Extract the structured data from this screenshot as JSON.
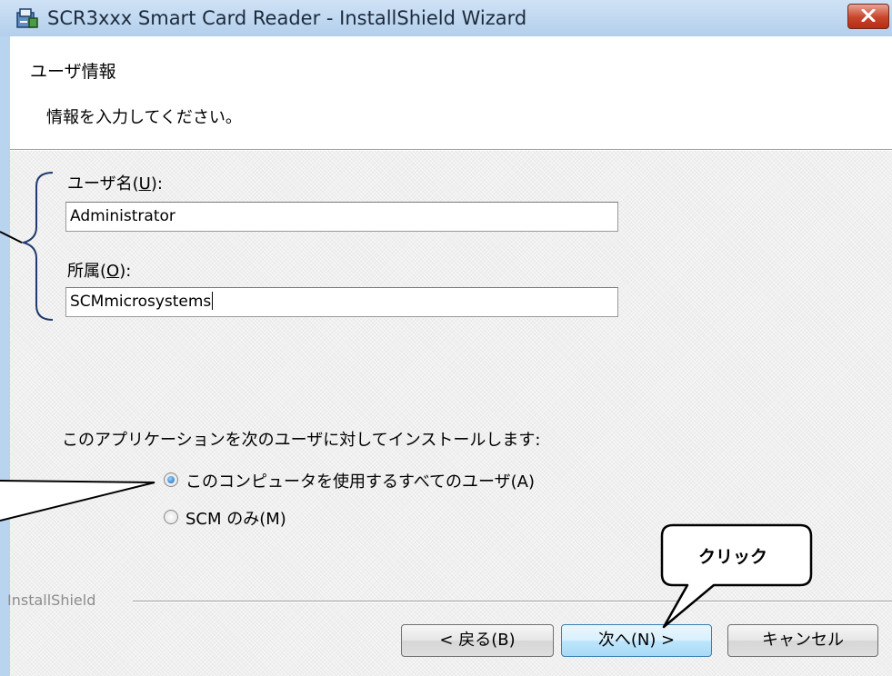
{
  "window": {
    "title": "SCR3xxx Smart Card Reader - InstallShield Wizard",
    "icon": "installer-icon"
  },
  "header": {
    "title": "ユーザ情報",
    "subtitle": "情報を入力してください。"
  },
  "form": {
    "username": {
      "label_prefix": "ユーザ名(",
      "label_key": "U",
      "label_suffix": "):",
      "value": "Administrator"
    },
    "organization": {
      "label_prefix": "所属(",
      "label_key": "O",
      "label_suffix": "):",
      "value": "SCMmicrosystems"
    }
  },
  "install_for": {
    "prompt": "このアプリケーションを次のユーザに対してインストールします:",
    "options": [
      {
        "label": "このコンピュータを使用するすべてのユーザ(A)",
        "selected": true
      },
      {
        "label": "SCM のみ(M)",
        "selected": false
      }
    ]
  },
  "footer": {
    "brand": "InstallShield",
    "back_label": "< 戻る(B)",
    "next_label": "次へ(N) >",
    "cancel_label": "キャンセル"
  },
  "annotation": {
    "callout_text": "クリック"
  },
  "colors": {
    "titlebar": "#b9d4ee",
    "dialog_bg": "#f0f0f0",
    "close_button": "#c8442b",
    "bracket": "#1f3a6e",
    "default_button": "#a7d9f5"
  }
}
